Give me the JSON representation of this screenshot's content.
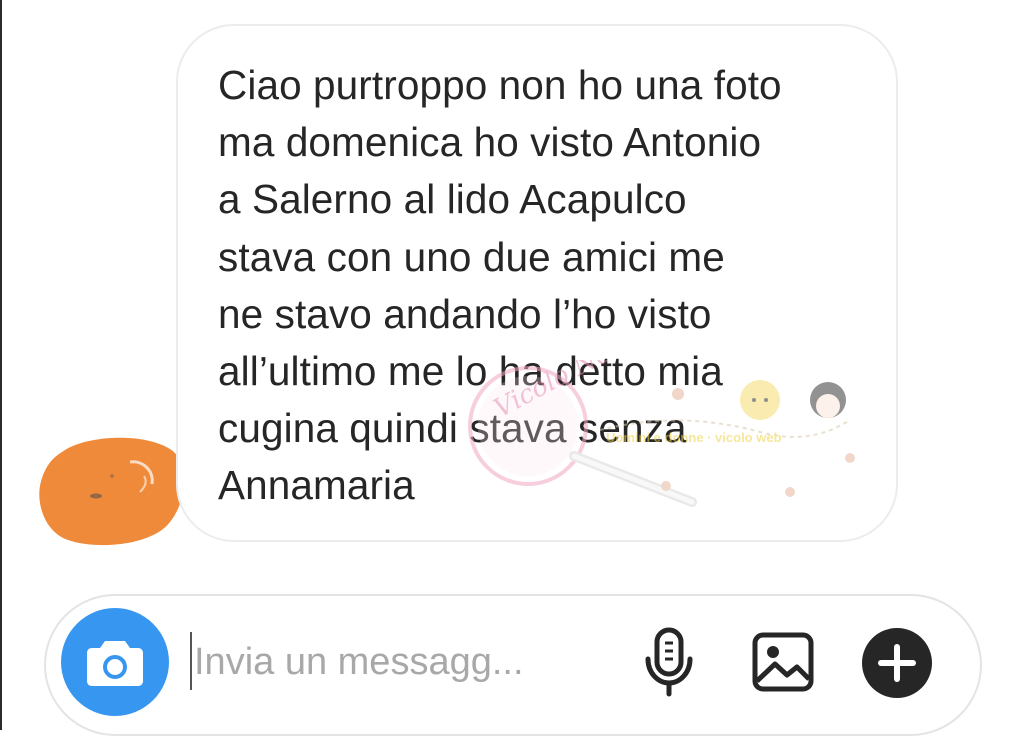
{
  "conversation": {
    "message": "Ciao purtroppo non ho una foto\nma domenica ho visto Antonio\na Salerno al lido Acapulco\nstava con uno due amici me\nne stavo andando l’ho visto\nall’ultimo me lo ha detto mia\ncugina quindi stava senza\nAnnamaria",
    "watermark": {
      "circle_text": "Vicolo News",
      "banner_text": "Uomini e donne · vicolo web"
    }
  },
  "composer": {
    "placeholder": "Invia un messagg...",
    "value": ""
  },
  "icons": {
    "camera": "camera-icon",
    "microphone": "microphone-icon",
    "gallery": "gallery-icon",
    "add": "plus-icon"
  },
  "colors": {
    "accent": "#3797f0",
    "avatar_redaction": "#ef8a3a",
    "bubble_border": "#ececec",
    "text": "#262626",
    "placeholder": "#a8a8a8",
    "watermark": "#f2a7c4"
  }
}
